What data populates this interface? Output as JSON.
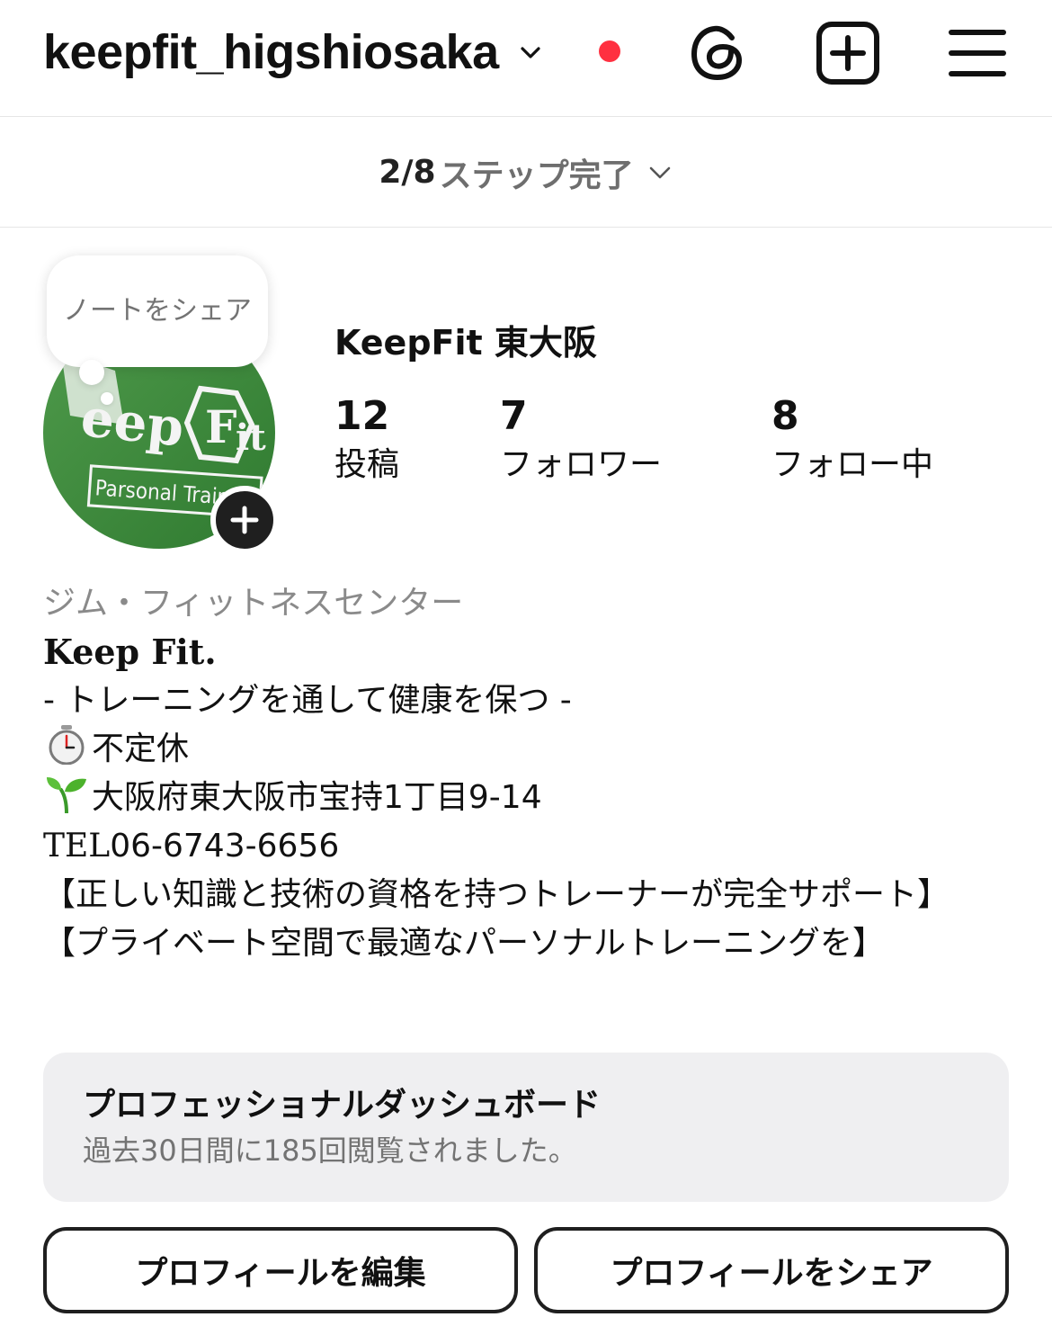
{
  "header": {
    "username": "keepfit_higshiosaka",
    "icons": [
      "chevron-down-icon",
      "notification-dot",
      "threads-icon",
      "create-post-icon",
      "menu-icon"
    ]
  },
  "steps": {
    "count": "2/8",
    "label": "ステップ完了"
  },
  "note": {
    "placeholder": "ノートをシェア"
  },
  "profile": {
    "display_name": "KeepFit 東大阪",
    "avatar_text": "KeepFit Parsonal Training",
    "stats": [
      {
        "value": "12",
        "label": "投稿"
      },
      {
        "value": "7",
        "label": "フォロワー"
      },
      {
        "value": "8",
        "label": "フォロー中"
      }
    ]
  },
  "bio": {
    "category": "ジム・フィットネスセンター",
    "title": "Keep Fit.",
    "tagline": "- トレーニングを通して健康を保つ -",
    "hours": "不定休",
    "address": "大阪府東大阪市宝持1丁目9-14",
    "tel_prefix": "TEL",
    "tel_number": "06-6743-6656",
    "line1": "【正しい知識と技術の資格を持つトレーナーが完全サポート】",
    "line2": "【プライベート空間で最適なパーソナルトレーニングを】"
  },
  "dashboard": {
    "title": "プロフェッショナルダッシュボード",
    "subtitle": "過去30日間に185回閲覧されました。"
  },
  "buttons": {
    "edit": "プロフィールを編集",
    "share": "プロフィールをシェア"
  },
  "colors": {
    "notification": "#ff3040",
    "avatar_green": "#3f8a3c",
    "card_bg": "#efeff1"
  }
}
